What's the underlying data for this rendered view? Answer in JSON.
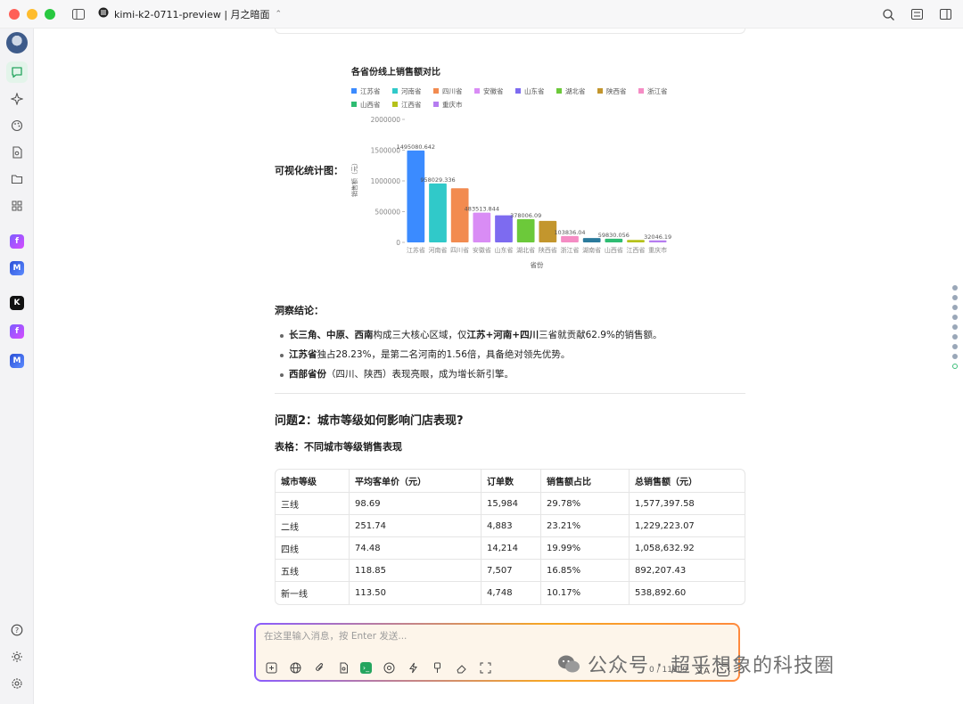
{
  "window": {
    "title": "kimi-k2-0711-preview | 月之暗面"
  },
  "sidebar": {
    "items": [
      "chat-icon",
      "sparkle-icon",
      "palette-icon",
      "file-search-icon",
      "folder-icon",
      "grid-icon"
    ],
    "apps": [
      {
        "name": "purple-app",
        "glyph": "f"
      },
      {
        "name": "blue-app",
        "glyph": "M"
      },
      {
        "name": "black-app",
        "glyph": "K"
      },
      {
        "name": "purple-app",
        "glyph": "f"
      },
      {
        "name": "blue-app",
        "glyph": "M"
      }
    ],
    "bottom": [
      "help-icon",
      "theme-icon",
      "settings-icon"
    ]
  },
  "viz_label": "可视化统计图：",
  "chart_data": {
    "type": "bar",
    "title": "各省份线上销售额对比",
    "xlabel": "省份",
    "ylabel": "销售额（元）",
    "ylim": [
      0,
      2000000
    ],
    "yticks": [
      "0",
      "500000",
      "1000000",
      "1500000",
      "2000000"
    ],
    "legend_position": "top",
    "categories": [
      "江苏省",
      "河南省",
      "四川省",
      "安徽省",
      "山东省",
      "湖北省",
      "陕西省",
      "浙江省",
      "湖南省",
      "山西省",
      "江西省",
      "重庆市"
    ],
    "values": [
      1495080.642,
      958029.336,
      880000,
      483513.844,
      440000,
      378006.09,
      350000,
      103836.04,
      70000,
      59830.056,
      40000,
      32046.19
    ],
    "data_labels": [
      "1495080.642",
      "958029.336",
      "",
      "483513.844",
      "",
      "378006.09",
      "",
      "103836.04",
      "",
      "59830.056",
      "",
      "32046.19"
    ],
    "colors": [
      "#3b8bff",
      "#30c9c9",
      "#f28b50",
      "#d98cf5",
      "#7d6bf0",
      "#6cc93a",
      "#c3962d",
      "#f58cc4",
      "#2a7a9c",
      "#2ebc72",
      "#b5c11a",
      "#b57cf0"
    ]
  },
  "insights": {
    "title": "洞察结论：",
    "bullets": [
      {
        "bold": "长三角、中原、西南",
        "text": "构成三大核心区域，仅",
        "bold2": "江苏+河南+四川",
        "text2": "三省就贡献62.9%的销售额。"
      },
      {
        "bold": "江苏省",
        "text": "独占28.23%，是第二名河南的1.56倍，具备绝对领先优势。",
        "bold2": "",
        "text2": ""
      },
      {
        "bold": "西部省份",
        "text": "（四川、陕西）表现亮眼，成为增长新引擎。",
        "bold2": "",
        "text2": ""
      }
    ]
  },
  "question2": {
    "title": "问题2：城市等级如何影响门店表现?",
    "table_caption": "表格：不同城市等级销售表现",
    "columns": [
      "城市等级",
      "平均客单价（元）",
      "订单数",
      "销售额占比",
      "总销售额（元）"
    ],
    "rows": [
      [
        "三线",
        "98.69",
        "15,984",
        "29.78%",
        "1,577,397.58"
      ],
      [
        "二线",
        "251.74",
        "4,883",
        "23.21%",
        "1,229,223.07"
      ],
      [
        "四线",
        "74.48",
        "14,214",
        "19.99%",
        "1,058,632.92"
      ],
      [
        "五线",
        "118.85",
        "7,507",
        "16.85%",
        "892,207.43"
      ],
      [
        "新一线",
        "113.50",
        "4,748",
        "10.17%",
        "538,892.60"
      ]
    ]
  },
  "composer": {
    "placeholder": "在这里输入消息，按 Enter 发送...",
    "token_info": "0 / 11109"
  },
  "watermark": "公众号 · 超乎想象的科技圈"
}
